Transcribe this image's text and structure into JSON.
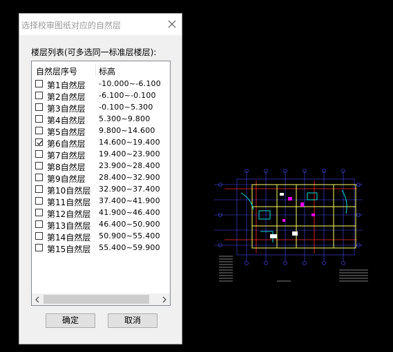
{
  "dialog": {
    "title": "选择校审图纸对应的自然层",
    "group_label": "楼层列表(可多选同一标准层楼层):",
    "columns": [
      "自然层序号",
      "标高"
    ],
    "floors": [
      {
        "name": "第1自然层",
        "elevation": "-10.000~-6.100",
        "checked": false
      },
      {
        "name": "第2自然层",
        "elevation": "-6.100~-0.100",
        "checked": false
      },
      {
        "name": "第3自然层",
        "elevation": "-0.100~5.300",
        "checked": false
      },
      {
        "name": "第4自然层",
        "elevation": "5.300~9.800",
        "checked": false
      },
      {
        "name": "第5自然层",
        "elevation": "9.800~14.600",
        "checked": false
      },
      {
        "name": "第6自然层",
        "elevation": "14.600~19.400",
        "checked": true
      },
      {
        "name": "第7自然层",
        "elevation": "19.400~23.900",
        "checked": false
      },
      {
        "name": "第8自然层",
        "elevation": "23.900~28.400",
        "checked": false
      },
      {
        "name": "第9自然层",
        "elevation": "28.400~32.900",
        "checked": false
      },
      {
        "name": "第10自然层",
        "elevation": "32.900~37.400",
        "checked": false
      },
      {
        "name": "第11自然层",
        "elevation": "37.400~41.900",
        "checked": false
      },
      {
        "name": "第12自然层",
        "elevation": "41.900~46.400",
        "checked": false
      },
      {
        "name": "第13自然层",
        "elevation": "46.400~50.900",
        "checked": false
      },
      {
        "name": "第14自然层",
        "elevation": "50.900~55.400",
        "checked": false
      },
      {
        "name": "第15自然层",
        "elevation": "55.400~59.900",
        "checked": false
      }
    ],
    "ok_label": "确定",
    "cancel_label": "取消"
  },
  "colors": {
    "canvas_background": "#000000",
    "dialog_background": "#f0f0f0",
    "drawing_grid": "#4b4bff",
    "drawing_axis": "#ff2a2a",
    "drawing_walls": "#ffff66",
    "drawing_accent": "#00e0e0",
    "drawing_highlight": "#ff00ff"
  },
  "icons": {
    "close": "close-icon",
    "checkmark": "checkmark-icon",
    "scroll_left": "arrow-left-icon",
    "scroll_right": "arrow-right-icon"
  }
}
